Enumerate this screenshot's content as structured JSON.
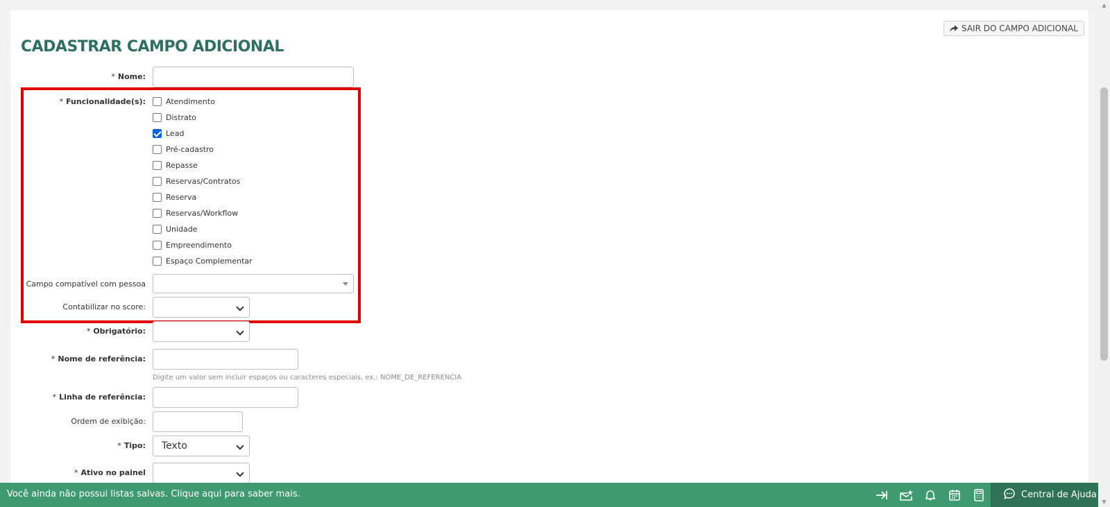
{
  "header": {
    "exit_label": "SAIR DO CAMPO ADICIONAL",
    "title": "CADASTRAR CAMPO ADICIONAL"
  },
  "form": {
    "nome": {
      "label": "Nome:",
      "value": ""
    },
    "funcionalidades": {
      "label": "Funcionalidade(s):",
      "options": [
        {
          "label": "Atendimento",
          "checked": false
        },
        {
          "label": "Distrato",
          "checked": false
        },
        {
          "label": "Lead",
          "checked": true
        },
        {
          "label": "Pré-cadastro",
          "checked": false
        },
        {
          "label": "Repasse",
          "checked": false
        },
        {
          "label": "Reservas/Contratos",
          "checked": false
        },
        {
          "label": "Reserva",
          "checked": false
        },
        {
          "label": "Reservas/Workflow",
          "checked": false
        },
        {
          "label": "Unidade",
          "checked": false
        },
        {
          "label": "Empreendimento",
          "checked": false
        },
        {
          "label": "Espaço Complementar",
          "checked": false
        }
      ]
    },
    "campo_compativel": {
      "label": "Campo compatível com pessoa",
      "value": ""
    },
    "contabilizar": {
      "label": "Contabilizar no score:",
      "value": ""
    },
    "obrigatorio": {
      "label": "Obrigatório:",
      "value": ""
    },
    "nome_referencia": {
      "label": "Nome de referência:",
      "value": "",
      "help": "Digite um valor sem incluir espaços ou caracteres especiais, ex.: NOME_DE_REFERENCIA"
    },
    "linha_referencia": {
      "label": "Linha de referência:",
      "value": ""
    },
    "ordem_exibicao": {
      "label": "Ordem de exibição:",
      "value": ""
    },
    "tipo": {
      "label": "Tipo:",
      "value": "Texto"
    },
    "ativo_painel": {
      "label": "Ativo no painel",
      "value": ""
    },
    "required_marker": "*"
  },
  "footer": {
    "message": "Você ainda não possui listas salvas. Clique aqui para saber mais.",
    "help_center": "Central de Ajuda",
    "icons": [
      "collapse-right-icon",
      "mail-star-icon",
      "bell-icon",
      "calendar-icon",
      "calculator-icon"
    ]
  },
  "colors": {
    "title": "#2f6f63",
    "footer": "#3f9a6f",
    "footer_dark": "#2f7258",
    "highlight": "#e00000",
    "checkbox_checked": "#0d63d6"
  }
}
